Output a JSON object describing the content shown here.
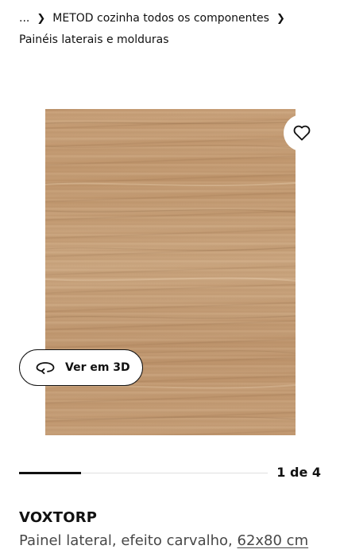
{
  "breadcrumb": {
    "ellipsis": "...",
    "items": [
      "METOD cozinha todos os componentes",
      "Painéis laterais e molduras"
    ]
  },
  "gallery": {
    "view_3d_label": "Ver em 3D",
    "counter": "1 de 4",
    "current_image": 1,
    "total_images": 4
  },
  "product": {
    "name": "VOXTORP",
    "description": "Painel lateral, efeito carvalho,",
    "size": "62x80 cm"
  },
  "icons": {
    "favourite": "heart-icon",
    "view_3d": "rotate-3d-icon",
    "breadcrumb_separator": "chevron-right-icon"
  },
  "colors": {
    "text": "#111111",
    "secondary_text": "#484848",
    "track": "#dfdfdf"
  }
}
